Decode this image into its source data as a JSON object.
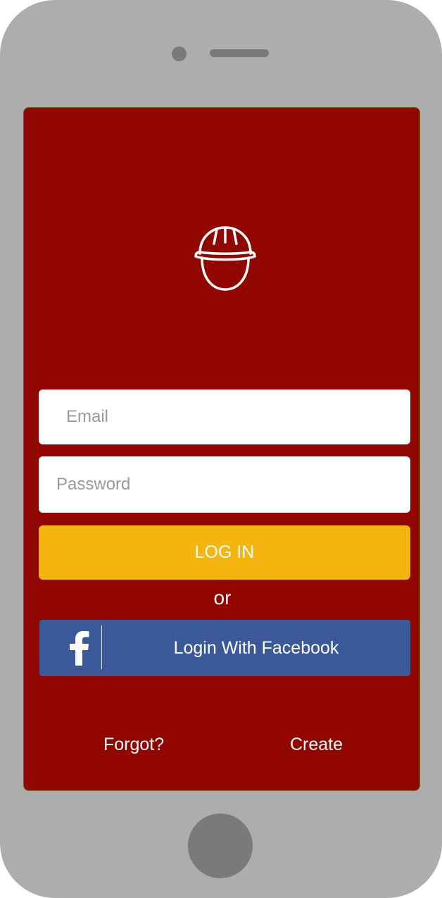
{
  "device": {
    "frame_color": "#adadad",
    "hardware_color": "#7a7a7a"
  },
  "app": {
    "background_color": "#920600",
    "logo_icon": "hard-hat-icon"
  },
  "form": {
    "email_placeholder": "Email",
    "password_placeholder": "Password",
    "login_label": "LOG IN",
    "login_color": "#f4b50c",
    "or_text": "or"
  },
  "facebook": {
    "icon": "facebook-icon",
    "label": "Login With Facebook",
    "color": "#3b5998"
  },
  "footer": {
    "forgot_label": "Forgot?",
    "create_label": "Create"
  }
}
